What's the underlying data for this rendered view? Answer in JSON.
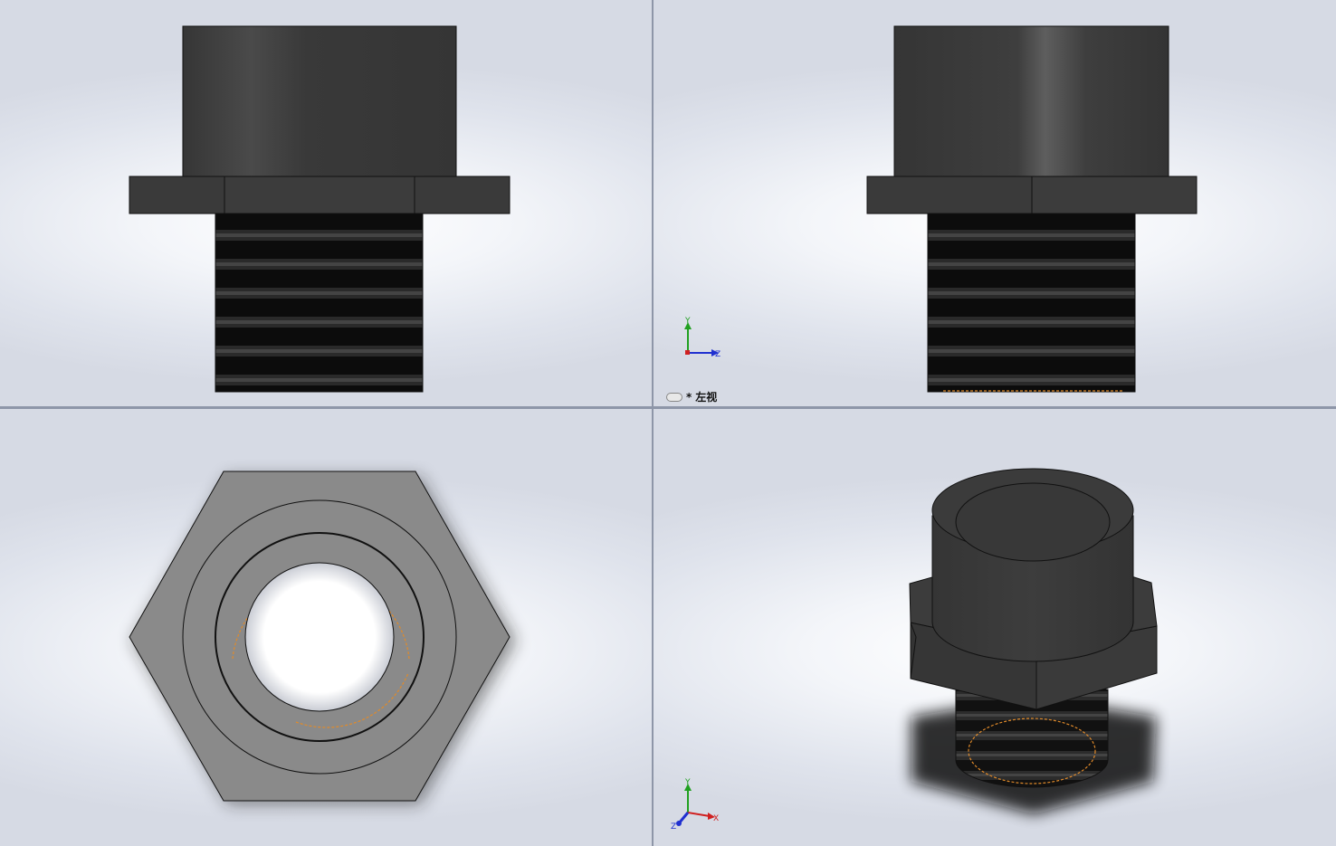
{
  "viewports": {
    "top_left": {
      "name": "front-view"
    },
    "top_right": {
      "name": "left-view",
      "label_prefix": "*",
      "label": "左视"
    },
    "bottom_left": {
      "name": "top-view"
    },
    "bottom_right": {
      "name": "isometric-view"
    }
  },
  "triad": {
    "left_view": {
      "y": "Y",
      "z": "Z"
    },
    "iso_view": {
      "y": "Y",
      "x": "X",
      "z": "Z"
    }
  },
  "colors": {
    "part_dark": "#3a3a3a",
    "part_gray": "#8a8a8a",
    "edge": "#111111",
    "thread_hint": "#e08a2a",
    "axis_x": "#d02020",
    "axis_y": "#20a020",
    "axis_z": "#2030d0"
  }
}
